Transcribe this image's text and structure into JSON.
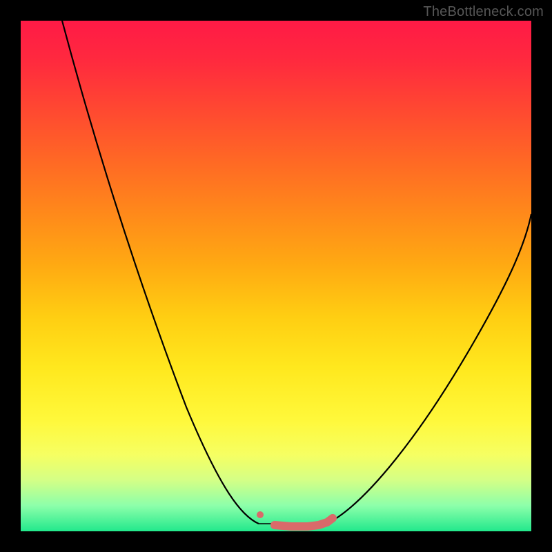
{
  "watermark": "TheBottleneck.com",
  "colors": {
    "background": "#000000",
    "curve_stroke": "#000000",
    "marker": "#d96a6a",
    "gradient_top": "#ff1a46",
    "gradient_bottom": "#22e88c"
  },
  "chart_data": {
    "type": "line",
    "title": "",
    "xlabel": "",
    "ylabel": "",
    "xlim": [
      0,
      100
    ],
    "ylim": [
      0,
      100
    ],
    "curve_left": {
      "x": [
        8,
        12,
        16,
        20,
        24,
        28,
        32,
        36,
        40,
        44,
        46
      ],
      "y": [
        100,
        89,
        78,
        67,
        56,
        45,
        35,
        25,
        15,
        5,
        2
      ]
    },
    "curve_right": {
      "x": [
        60,
        64,
        68,
        72,
        76,
        80,
        84,
        88,
        92,
        96,
        100
      ],
      "y": [
        2,
        6,
        11,
        17,
        23,
        30,
        37,
        45,
        53,
        61,
        62
      ]
    },
    "markers": {
      "x": [
        46,
        50,
        51,
        52,
        53,
        54,
        55,
        56,
        57,
        58,
        59,
        60
      ],
      "y": [
        2.5,
        0.8,
        0.7,
        0.7,
        0.7,
        0.7,
        0.8,
        0.9,
        1.0,
        1.2,
        1.4,
        1.7
      ]
    }
  }
}
